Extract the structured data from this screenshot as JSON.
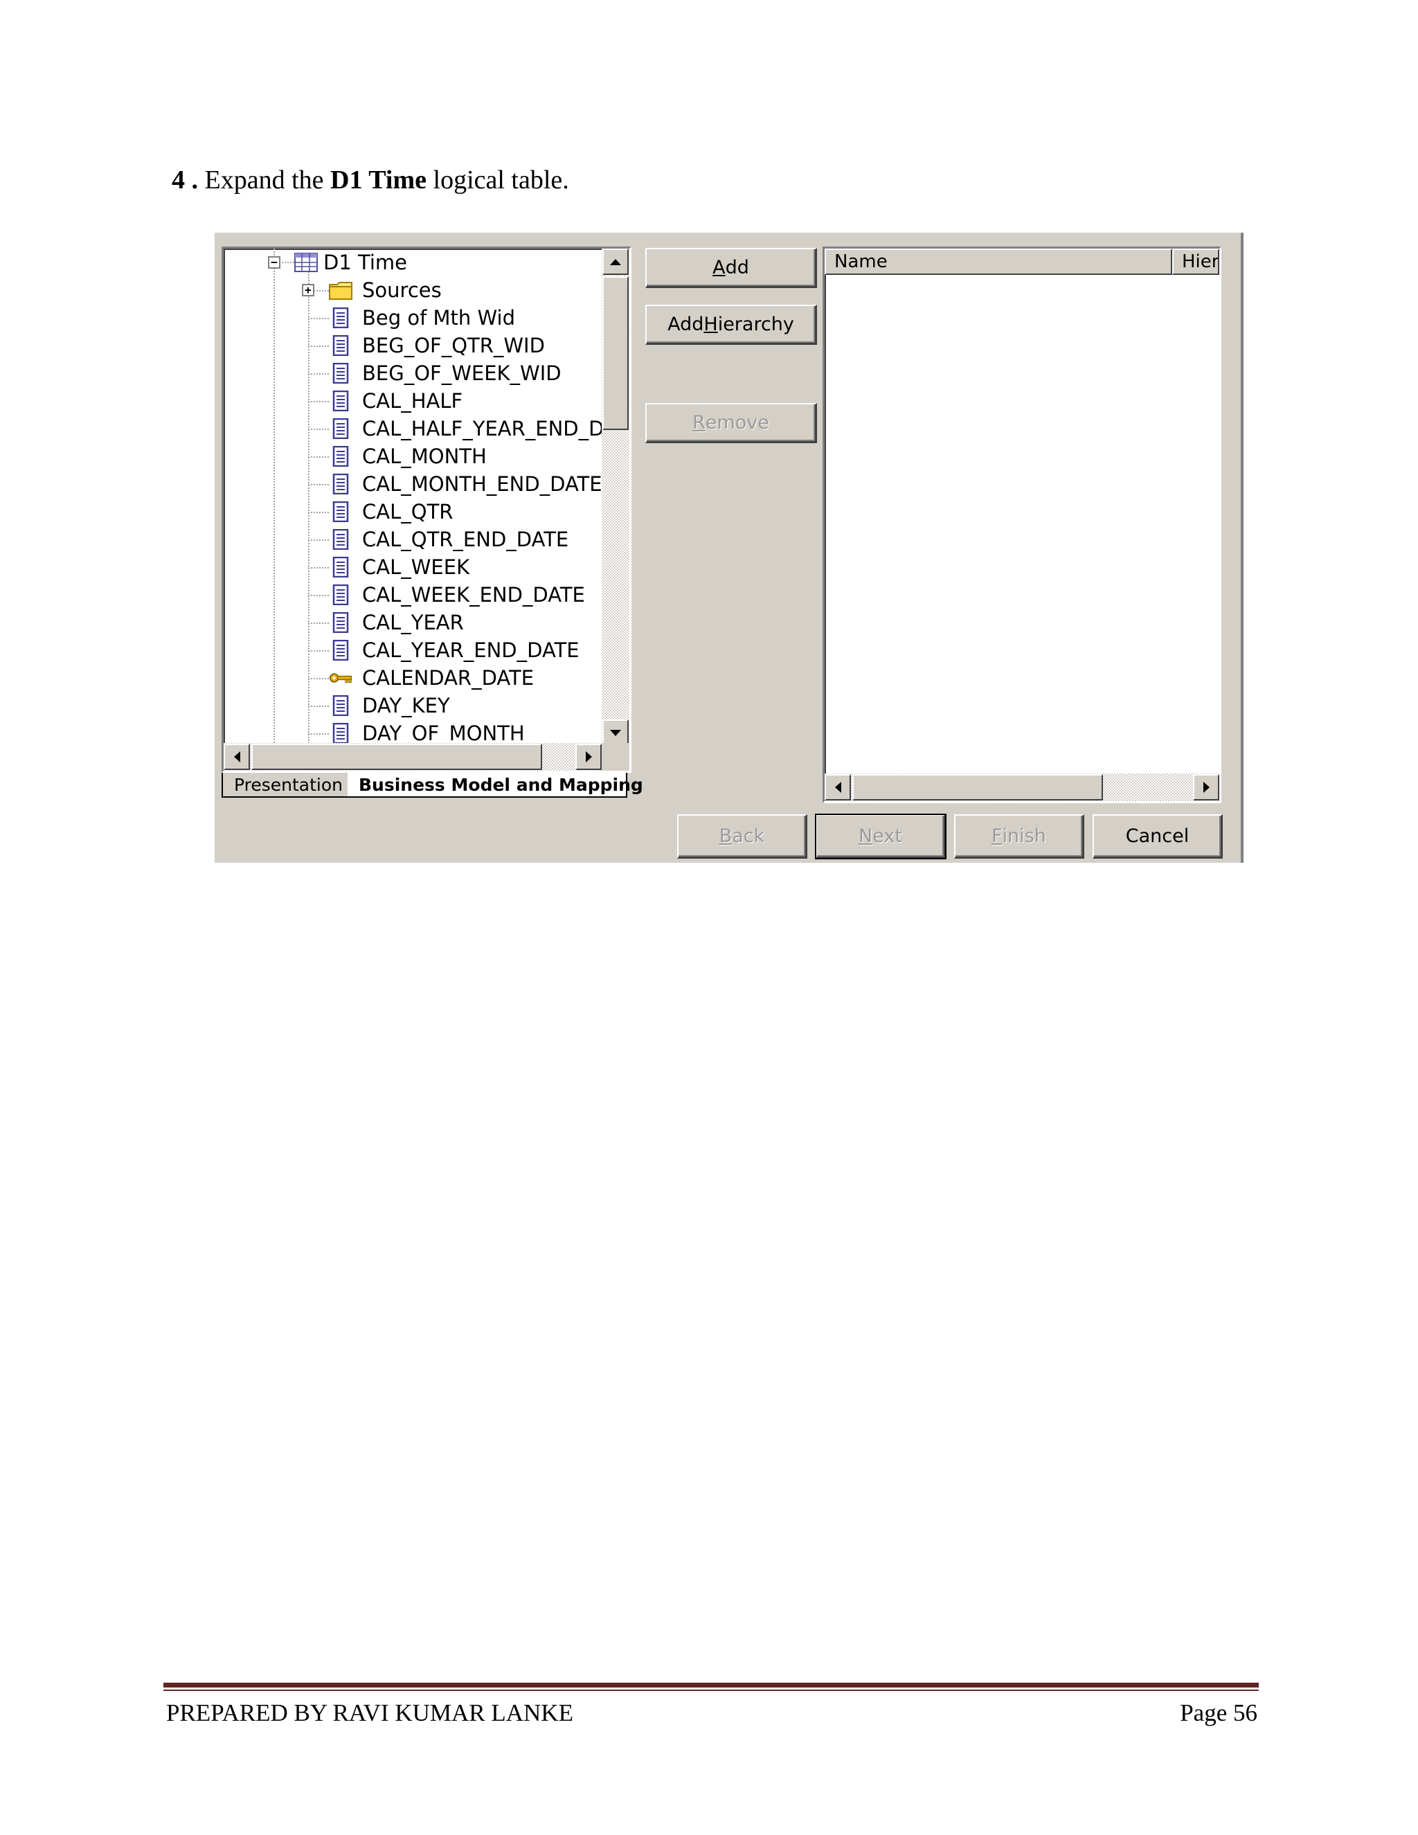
{
  "step": {
    "number": "4 .",
    "text_before": "Expand the",
    "bold_text": "D1 Time",
    "text_after": "logical table."
  },
  "tree": {
    "root": {
      "label": "D1 Time",
      "icon": "logical-table-icon",
      "expanded": true
    },
    "items": [
      {
        "label": "Sources",
        "icon": "folder-icon",
        "expandable": true
      },
      {
        "label": "Beg of Mth Wid",
        "icon": "column-icon"
      },
      {
        "label": "BEG_OF_QTR_WID",
        "icon": "column-icon"
      },
      {
        "label": "BEG_OF_WEEK_WID",
        "icon": "column-icon"
      },
      {
        "label": "CAL_HALF",
        "icon": "column-icon"
      },
      {
        "label": "CAL_HALF_YEAR_END_DA",
        "icon": "column-icon"
      },
      {
        "label": "CAL_MONTH",
        "icon": "column-icon"
      },
      {
        "label": "CAL_MONTH_END_DATE",
        "icon": "column-icon"
      },
      {
        "label": "CAL_QTR",
        "icon": "column-icon"
      },
      {
        "label": "CAL_QTR_END_DATE",
        "icon": "column-icon"
      },
      {
        "label": "CAL_WEEK",
        "icon": "column-icon"
      },
      {
        "label": "CAL_WEEK_END_DATE",
        "icon": "column-icon"
      },
      {
        "label": "CAL_YEAR",
        "icon": "column-icon"
      },
      {
        "label": "CAL_YEAR_END_DATE",
        "icon": "column-icon"
      },
      {
        "label": "CALENDAR_DATE",
        "icon": "key-icon"
      },
      {
        "label": "DAY_KEY",
        "icon": "column-icon"
      },
      {
        "label": "DAY_OF_MONTH",
        "icon": "column-icon"
      }
    ]
  },
  "tabs": {
    "presentation": "Presentation",
    "business_model": "Business Model and Mapping",
    "active": "Business Model and Mapping"
  },
  "buttons": {
    "add": {
      "pre": "",
      "accel": "A",
      "post": "dd"
    },
    "add_hierarchy": {
      "pre": "Add ",
      "accel": "H",
      "post": "ierarchy"
    },
    "remove": {
      "pre": "",
      "accel": "R",
      "post": "emove"
    },
    "back": {
      "pre": "",
      "accel": "B",
      "post": "ack"
    },
    "next": {
      "pre": "",
      "accel": "N",
      "post": "ext"
    },
    "finish": {
      "pre": "",
      "accel": "F",
      "post": "inish"
    },
    "cancel": {
      "label": "Cancel"
    }
  },
  "list": {
    "columns": [
      "Name",
      "Hier"
    ]
  },
  "footer": {
    "left": "PREPARED BY RAVI KUMAR LANKE",
    "right": "Page 56"
  },
  "colors": {
    "dialog_bg": "#d4d0c8",
    "footer_rule": "#632423",
    "column_icon": "#3b3b8f",
    "key_icon": "#e0b000"
  }
}
